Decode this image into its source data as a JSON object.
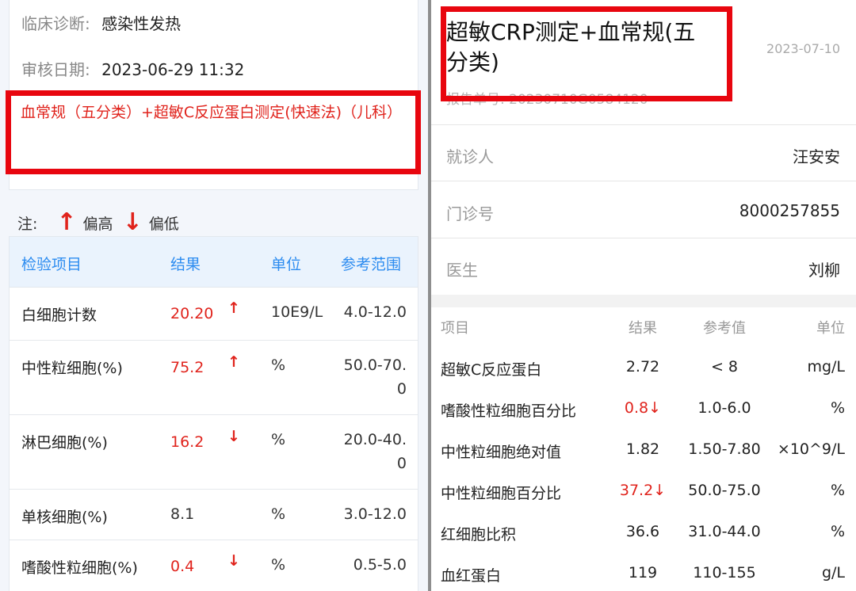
{
  "left": {
    "diagnosis": {
      "label": "临床诊断:",
      "value": "感染性发热"
    },
    "review_date": {
      "label": "审核日期:",
      "value": "2023-06-29 11:32"
    },
    "test_name": "血常规（五分类）+超敏C反应蛋白测定(快速法)（儿科）",
    "note": {
      "label": "注:",
      "high_arrow": "↑",
      "high": "偏高",
      "low_arrow": "↓",
      "low": "偏低"
    },
    "columns": [
      "检验项目",
      "结果",
      "单位",
      "参考范围"
    ],
    "rows": [
      {
        "name": "白细胞计数",
        "result": "20.20",
        "flag": "↑",
        "unit": "10E9/L",
        "ref": "4.0-12.0"
      },
      {
        "name": "中性粒细胞(%)",
        "result": "75.2",
        "flag": "↑",
        "unit": "%",
        "ref": "50.0-70.0"
      },
      {
        "name": "淋巴细胞(%)",
        "result": "16.2",
        "flag": "↓",
        "unit": "%",
        "ref": "20.0-40.0"
      },
      {
        "name": "单核细胞(%)",
        "result": "8.1",
        "flag": "",
        "unit": "%",
        "ref": "3.0-12.0"
      },
      {
        "name": "嗜酸性粒细胞(%)",
        "result": "0.4",
        "flag": "↓",
        "unit": "%",
        "ref": "0.5-5.0"
      }
    ]
  },
  "right": {
    "title": "超敏CRP测定+血常规(五分类)",
    "date": "2023-07-10",
    "report_no": "报告单号: 20230710G0584120",
    "patient": {
      "label": "就诊人",
      "value": "汪安安"
    },
    "clinic_no": {
      "label": "门诊号",
      "value": "8000257855"
    },
    "doctor": {
      "label": "医生",
      "value": "刘柳"
    },
    "columns": [
      "项目",
      "结果",
      "参考值",
      "单位"
    ],
    "rows": [
      {
        "name": "超敏C反应蛋白",
        "result": "2.72",
        "flag": "",
        "ref": "< 8",
        "unit": "mg/L"
      },
      {
        "name": "嗜酸性粒细胞百分比",
        "result": "0.8",
        "flag": "↓",
        "ref": "1.0-6.0",
        "unit": "%"
      },
      {
        "name": "中性粒细胞绝对值",
        "result": "1.82",
        "flag": "",
        "ref": "1.50-7.80",
        "unit": "×10^9/L"
      },
      {
        "name": "中性粒细胞百分比",
        "result": "37.2",
        "flag": "↓",
        "ref": "50.0-75.0",
        "unit": "%"
      },
      {
        "name": "红细胞比积",
        "result": "36.6",
        "flag": "",
        "ref": "31.0-44.0",
        "unit": "%"
      },
      {
        "name": "血红蛋白",
        "result": "119",
        "flag": "",
        "ref": "110-155",
        "unit": "g/L"
      }
    ]
  },
  "colors": {
    "accent_blue": "#2d8cf0",
    "alert_red": "#e0231c",
    "highlight_box": "#e8060f"
  }
}
